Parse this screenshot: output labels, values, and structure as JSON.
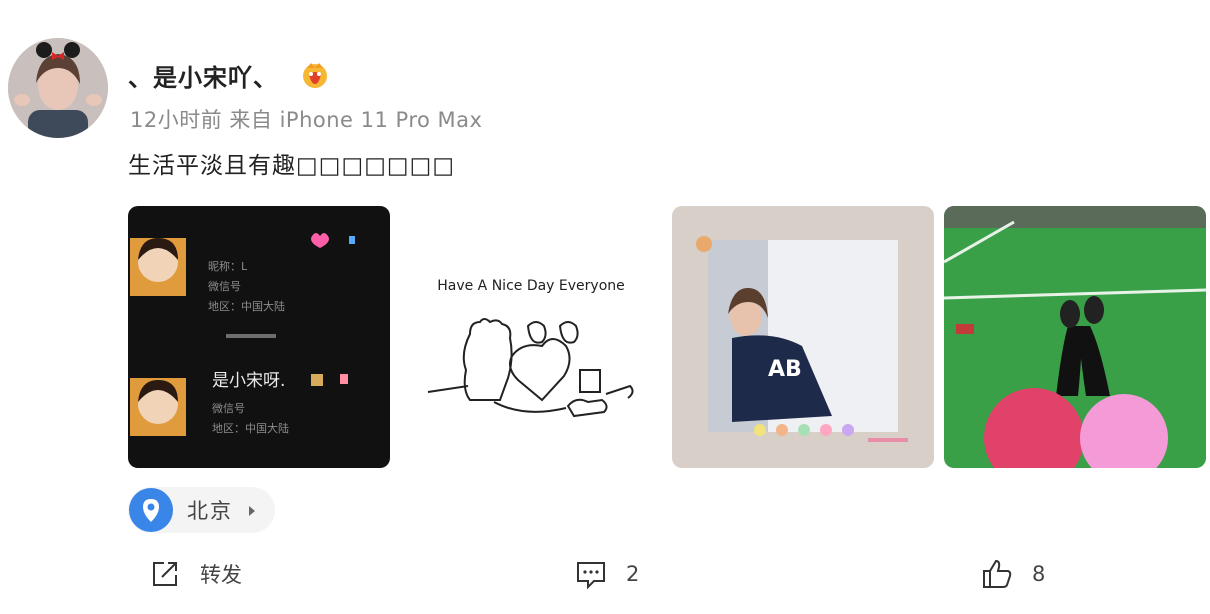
{
  "post": {
    "username": "、是小宋吖、",
    "meta": "12小时前 来自 iPhone 11 Pro Max",
    "content": "生活平淡且有趣□□□□□□□",
    "photo2_caption": "Have A Nice Day Everyone",
    "photo1_lines": {
      "nick": "昵称：L",
      "wechat": "微信号",
      "region": "地区：中国大陆",
      "name2": "是小宋呀.",
      "wechat2": "微信号",
      "region2": "地区：中国大陆"
    }
  },
  "location": {
    "label": "北京"
  },
  "actions": {
    "share_label": "转发",
    "comment_count": "2",
    "like_count": "8"
  },
  "colors": {
    "accent": "#3a86e8",
    "text": "#222222",
    "meta": "#8a8a8a"
  },
  "icons": [
    "user-avatar",
    "vip-badge-icon",
    "location-pin-icon",
    "chevron-right-icon",
    "share-icon",
    "comment-icon",
    "like-icon"
  ]
}
